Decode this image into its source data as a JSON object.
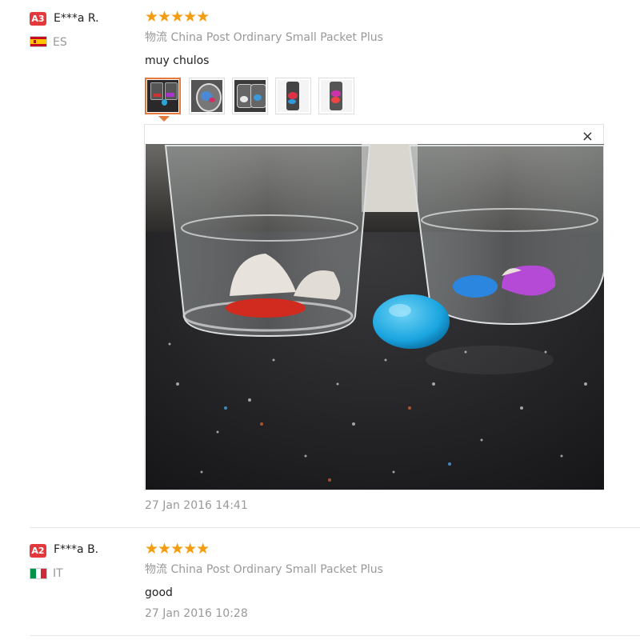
{
  "reviews": [
    {
      "badge": "A3",
      "user": "E***a R.",
      "country": "ES",
      "rating": 5,
      "stars": "★★★★★",
      "logistics_label": "物流",
      "logistics": "China Post Ordinary Small Packet Plus",
      "comment": "muy chulos",
      "date": "27 Jan 2016 14:41",
      "close": "×"
    },
    {
      "badge": "A2",
      "user": "F***a B.",
      "country": "IT",
      "rating": 5,
      "stars": "★★★★★",
      "logistics_label": "物流",
      "logistics": "China Post Ordinary Small Packet Plus",
      "comment": "good",
      "date": "27 Jan 2016 10:28"
    }
  ],
  "icons": {
    "star": "star-icon",
    "close": "close-icon",
    "flag_es": "spain-flag-icon",
    "flag_it": "italy-flag-icon"
  },
  "colors": {
    "badge": "#e4393c",
    "star": "#f39c12",
    "selected_thumb": "#e4793c"
  }
}
